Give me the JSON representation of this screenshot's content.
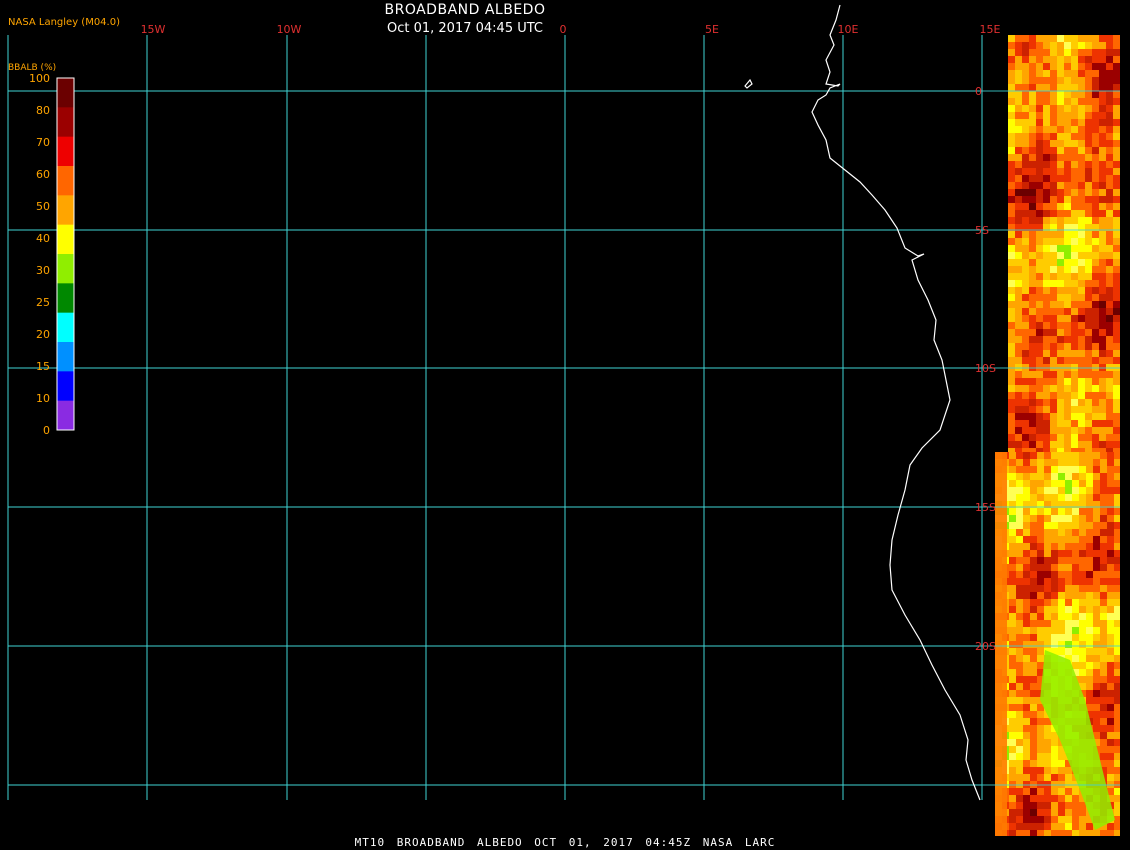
{
  "header": {
    "title": "BROADBAND ALBEDO",
    "subtitle": "Oct 01, 2017 04:45 UTC",
    "org": "NASA Langley (M04.0)"
  },
  "legend": {
    "title": "BBALB (%)",
    "levels": [
      "100",
      "80",
      "70",
      "60",
      "50",
      "40",
      "30",
      "25",
      "20",
      "15",
      "10",
      "0"
    ],
    "colors": [
      "#6b0000",
      "#9b0000",
      "#ee0000",
      "#ff6600",
      "#ffa500",
      "#ffff00",
      "#90ee00",
      "#008800",
      "#00ffff",
      "#0090ff",
      "#0000ff",
      "#8a2be2"
    ]
  },
  "grid": {
    "longitude_labels": [
      "15W",
      "10W",
      "0",
      "5E",
      "10E",
      "15E"
    ],
    "latitude_labels": [
      "0",
      "5S",
      "10S",
      "15S",
      "20S"
    ]
  },
  "footer": "MT10 BROADBAND ALBEDO OCT 01, 2017 04:45Z NASA LARC",
  "colors": {
    "grid": "#3fd3d3",
    "grid_label": "#e03030",
    "coastline": "#ffffff",
    "text_orange": "#ffa500",
    "background": "#000000"
  }
}
